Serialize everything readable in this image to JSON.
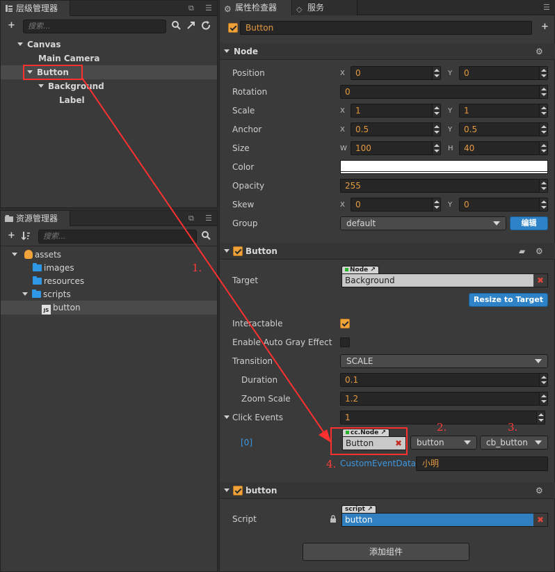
{
  "hierarchy": {
    "tab_label": "层级管理器",
    "search_placeholder": "搜索...",
    "nodes": [
      "Canvas",
      "Main Camera",
      "Button",
      "Background",
      "Label"
    ]
  },
  "assets": {
    "tab_label": "资源管理器",
    "search_placeholder": "搜索...",
    "items": [
      "assets",
      "images",
      "resources",
      "scripts",
      "button"
    ],
    "js_badge": "JS"
  },
  "inspector": {
    "tab_label": "属性检查器",
    "service_tab_label": "服务",
    "node_name": "Button",
    "node_section": {
      "title": "Node",
      "position": {
        "label": "Position",
        "x_axis": "X",
        "x": "0",
        "y_axis": "Y",
        "y": "0"
      },
      "rotation": {
        "label": "Rotation",
        "value": "0"
      },
      "scale": {
        "label": "Scale",
        "x_axis": "X",
        "x": "1",
        "y_axis": "Y",
        "y": "1"
      },
      "anchor": {
        "label": "Anchor",
        "x_axis": "X",
        "x": "0.5",
        "y_axis": "Y",
        "y": "0.5"
      },
      "size": {
        "label": "Size",
        "w_axis": "W",
        "w": "100",
        "h_axis": "H",
        "h": "40"
      },
      "color": {
        "label": "Color",
        "value": "#ffffff"
      },
      "opacity": {
        "label": "Opacity",
        "value": "255"
      },
      "skew": {
        "label": "Skew",
        "x_axis": "X",
        "x": "0",
        "y_axis": "Y",
        "y": "0"
      },
      "group": {
        "label": "Group",
        "value": "default",
        "edit_button": "编辑"
      }
    },
    "button_section": {
      "title": "Button",
      "target": {
        "label": "Target",
        "type_tag": "Node",
        "value": "Background"
      },
      "resize_button": "Resize to Target",
      "interactable": {
        "label": "Interactable",
        "checked": true
      },
      "auto_gray": {
        "label": "Enable Auto Gray Effect",
        "checked": false
      },
      "transition": {
        "label": "Transition",
        "value": "SCALE"
      },
      "duration": {
        "label": "Duration",
        "value": "0.1"
      },
      "zoom_scale": {
        "label": "Zoom Scale",
        "value": "1.2"
      },
      "click_events": {
        "label": "Click Events",
        "count": "1",
        "index_label": "[0]",
        "node_tag": "cc.Node",
        "node_value": "Button",
        "component": "button",
        "handler": "cb_button",
        "custom_data_label": "CustomEventData",
        "custom_data_value": "小明"
      }
    },
    "script_section": {
      "title": "button",
      "script_label": "Script",
      "type_tag": "script",
      "value": "button"
    },
    "add_component_button": "添加组件"
  },
  "annotations": [
    "1.",
    "2.",
    "3.",
    "4."
  ],
  "colors": {
    "accent": "#f0a23b",
    "blue": "#2d82c8",
    "annotation_red": "#ff3030"
  }
}
